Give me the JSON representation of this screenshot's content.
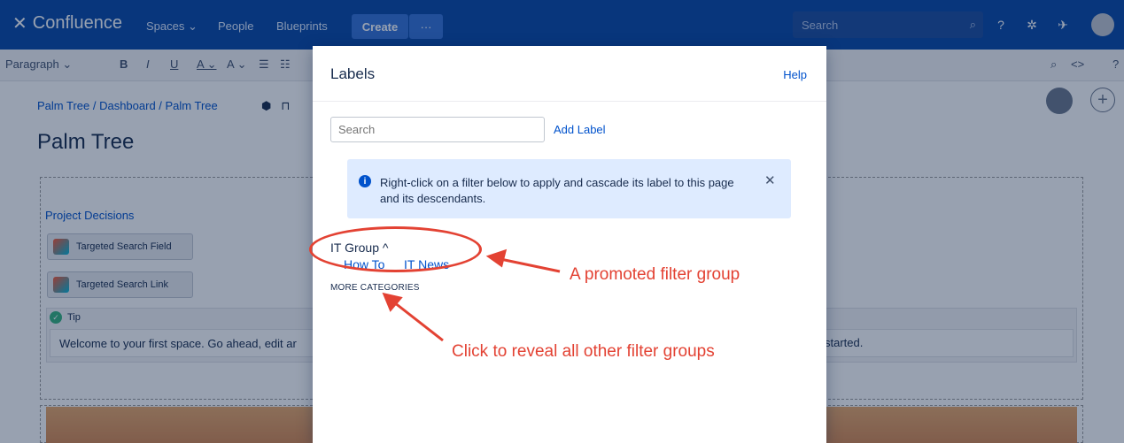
{
  "topnav": {
    "brand": "Confluence",
    "items": [
      "Spaces ⌄",
      "People",
      "Blueprints"
    ],
    "create": "Create",
    "more": "···",
    "search_placeholder": "Search"
  },
  "toolbar": {
    "paragraph": "Paragraph ⌄",
    "bold": "B",
    "italic": "I",
    "underline": "U",
    "color": "A ⌄",
    "format": "A ⌄",
    "list": "☰",
    "list2": "☷"
  },
  "page": {
    "breadcrumb": "Palm Tree / Dashboard / Palm Tree",
    "title": "Palm Tree",
    "project_decisions": "Project Decisions",
    "macro1": "Targeted Search Field",
    "macro2": "Targeted Search Link",
    "tip_label": "Tip",
    "tip_text": "Welcome to your first space. Go ahead, edit ar",
    "tip_text_end": "started."
  },
  "dialog": {
    "title": "Labels",
    "help": "Help",
    "search_placeholder": "Search",
    "add_label": "Add Label",
    "info": "Right-click on a filter below to apply and cascade its label to this page and its descendants.",
    "group_title": "IT Group ^",
    "filters": [
      "How To",
      "IT News"
    ],
    "more_categories": "MORE CATEGORIES"
  },
  "annotations": {
    "promoted": "A promoted filter group",
    "reveal": "Click to reveal all other filter groups",
    "color": "#e34233"
  }
}
